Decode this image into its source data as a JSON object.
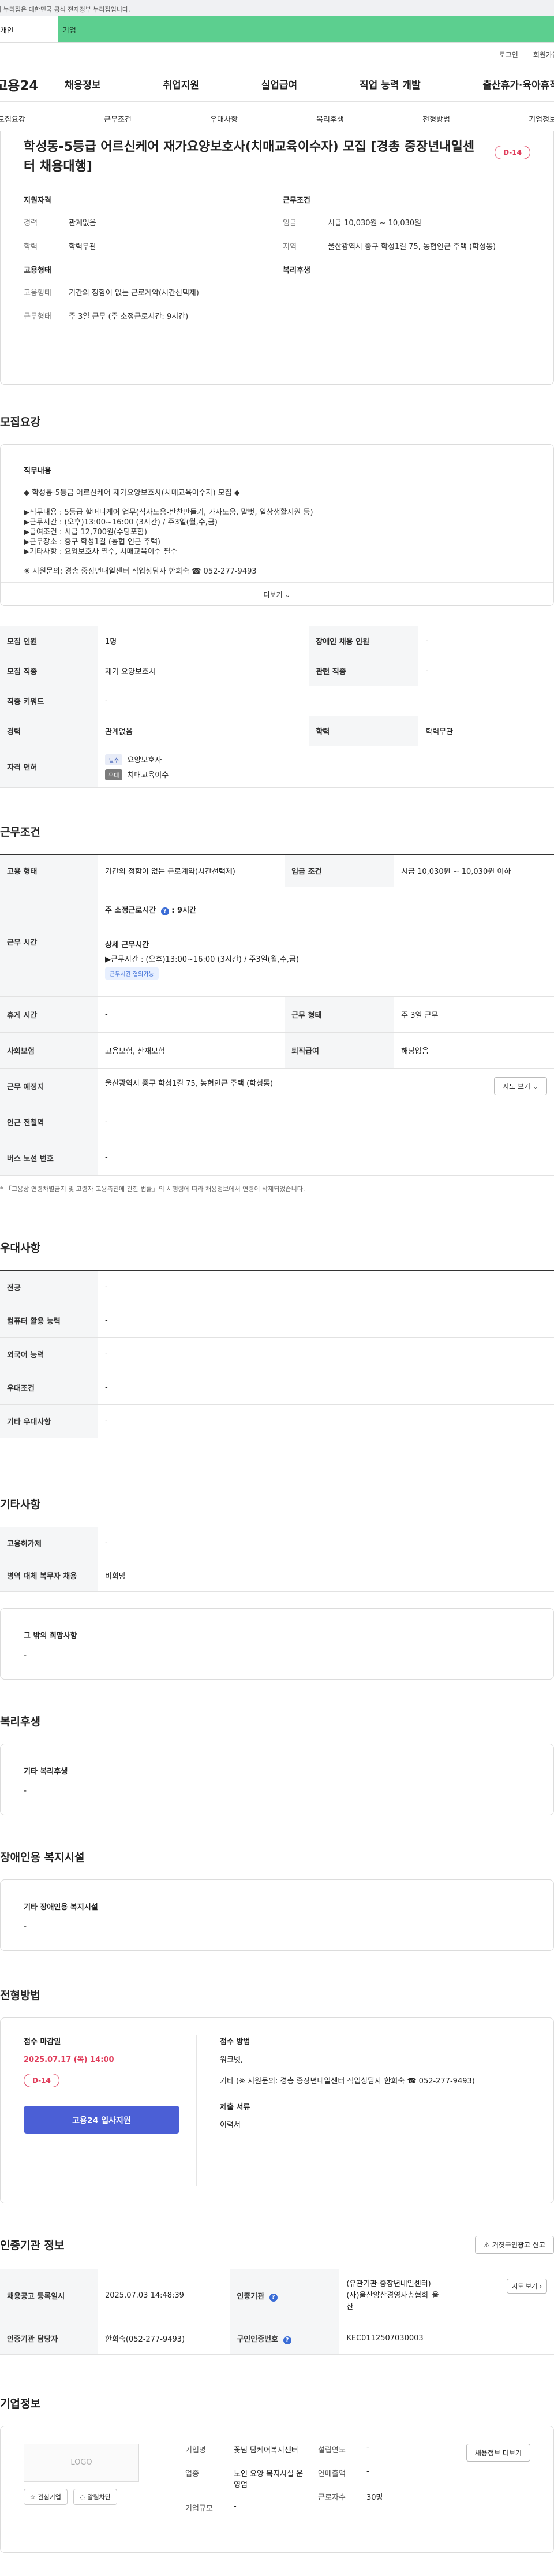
{
  "gov_notice": "이 누리집은 대한민국 공식 전자정부 누리집입니다.",
  "tabs": {
    "personal": "개인",
    "corporate": "기업"
  },
  "util": {
    "login": "로그인",
    "signup": "회원가입"
  },
  "logo": "고용24",
  "gnb": [
    "채용정보",
    "취업지원",
    "실업급여",
    "직업 능력 개발",
    "출산휴가·육아휴직"
  ],
  "snb": [
    "모집요강",
    "근무조건",
    "우대사항",
    "복리후생",
    "전형방법",
    "기업정보"
  ],
  "title": "학성동-5등급 어르신케어 재가요양보호사(치매교육이수자) 모집 [경총 중장년내일센터 채용대행]",
  "dday": "D-14",
  "summary": {
    "qual_title": "지원자격",
    "career_k": "경력",
    "career_v": "관계없음",
    "edu_k": "학력",
    "edu_v": "학력무관",
    "work_title": "근무조건",
    "wage_k": "임금",
    "wage_v": "시급 10,030원 ~ 10,030원",
    "region_k": "지역",
    "region_v": "울산광역시 중구 학성1길 75, 농협인근 주택 (학성동)",
    "emp_title": "고용형태",
    "emptype_k": "고용형태",
    "emptype_v": "기간의 정함이 없는 근로계약(시간선택제)",
    "worktype_k": "근무형태",
    "worktype_v": "주 3일 근무 (주 소정근로시간: 9시간)",
    "welfare_title": "복리후생"
  },
  "recruit": {
    "section": "모집요강",
    "job_title": "직무내용",
    "lines": [
      "◆ 학성동-5등급 어르신케어 재가요양보호사(치매교육이수자) 모집 ◆",
      "",
      "▶직무내용 : 5등급 할머니케어 업무(식사도움-반찬만들기, 가사도움, 말벗, 일상생활지원 등)",
      "▶근무시간 : (오후)13:00~16:00 (3시간) / 주3일(월,수,금)",
      "▶급여조건 : 시급 12,700원(수당포함)",
      "▶근무장소 : 중구 학성1길 (농협 인근 주택)",
      "▶기타사항 : 요양보호사 필수, 치매교육이수 필수",
      "",
      "※ 지원문의: 경총 중장년내일센터 직업상담사 한희숙 ☎ 052-277-9493"
    ],
    "more": "더보기"
  },
  "recruit_table": {
    "headcount_k": "모집 인원",
    "headcount_v": "1명",
    "disabled_k": "장애인 채용 인원",
    "disabled_v": "-",
    "job_k": "모집 직종",
    "job_v": "재가 요양보호사",
    "related_k": "관련 직종",
    "related_v": "-",
    "keyword_k": "직종 키워드",
    "keyword_v": "-",
    "career_k": "경력",
    "career_v": "관계없음",
    "edu_k": "학력",
    "edu_v": "학력무관",
    "license_k": "자격 면허",
    "license_req_tag": "필수",
    "license_req_v": "요양보호사",
    "license_pref_tag": "우대",
    "license_pref_v": "치매교육이수"
  },
  "work": {
    "section": "근무조건",
    "emptype_k": "고용 형태",
    "emptype_v": "기간의 정함이 없는 근로계약(시간선택제)",
    "wage_k": "임금 조건",
    "wage_v": "시급 10,030원 ~ 10,030원 이하",
    "hours_k": "근무 시간",
    "hours_main": "주 소정근로시간",
    "hours_main_v": "9시간",
    "hours_detail_title": "상세 근무시간",
    "hours_detail": "▶근무시간 : (오후)13:00~16:00 (3시간) / 주3일(월,수,금)",
    "hours_tag": "근무시간 협의가능",
    "rest_k": "휴게 시간",
    "rest_v": "-",
    "form_k": "근무 형태",
    "form_v": "주 3일 근무",
    "insurance_k": "사회보험",
    "insurance_v": "고용보험, 산재보험",
    "severance_k": "퇴직급여",
    "severance_v": "해당없음",
    "place_k": "근무 예정지",
    "place_v": "울산광역시 중구 학성1길 75, 농협인근 주택 (학성동)",
    "map_btn": "지도 보기",
    "subway_k": "인근 전철역",
    "subway_v": "-",
    "bus_k": "버스 노선 번호",
    "bus_v": "-",
    "note": "* 「고용상 연령차별금지 및 고령자 고용촉진에 관한 법률」의 시행령에 따라 채용정보에서 연령이 삭제되었습니다."
  },
  "pref": {
    "section": "우대사항",
    "major_k": "전공",
    "major_v": "-",
    "computer_k": "컴퓨터 활용 능력",
    "computer_v": "-",
    "lang_k": "외국어 능력",
    "lang_v": "-",
    "cond_k": "우대조건",
    "cond_v": "-",
    "etc_k": "기타 우대사항",
    "etc_v": "-"
  },
  "etc": {
    "section": "기타사항",
    "equip_k": "고용허가제",
    "equip_v": "-",
    "military_k": "병역 대체 복무자 채용",
    "military_v": "비희망",
    "other_title": "그 밖의 희망사항",
    "other_v": "-"
  },
  "welfare": {
    "section": "복리후생",
    "title": "기타 복리후생",
    "value": "-"
  },
  "disabled_facility": {
    "section": "장애인용 복지시설",
    "title": "기타 장애인용 복지시설",
    "value": "-"
  },
  "apply": {
    "section": "전형방법",
    "deadline_title": "접수 마감일",
    "deadline": "2025.07.17 (목) 14:00",
    "dday": "D-14",
    "apply_btn": "고용24 입사지원",
    "method_title": "접수 방법",
    "method_1": "워크넷,",
    "method_2": "기타 (※ 지원문의: 경총 중장년내일센터 직업상담사 한희숙 ☎ 052-277-9493)",
    "docs_title": "제출 서류",
    "docs_v": "이력서"
  },
  "cert": {
    "section": "인증기관 정보",
    "report_btn": "거짓구인광고 신고",
    "reg_k": "채용공고 등록일시",
    "reg_v": "2025.07.03 14:48:39",
    "agency_k": "인증기관",
    "agency_v": "(유관기관-중장년내일센터) (사)울산양산경영자총협회_울산",
    "map_btn": "지도 보기",
    "manager_k": "인증기관 담당자",
    "manager_v": "한희숙(052-277-9493)",
    "jobno_k": "구인인증번호",
    "jobno_v": "KEC0112507030003"
  },
  "company": {
    "section": "기업정보",
    "logo_text": "LOGO",
    "interest_btn": "관심기업",
    "alarm_btn": "알림차단",
    "name_k": "기업명",
    "name_v": "꽃님 탐케어복지센터",
    "industry_k": "업종",
    "industry_v": "노인 요양 복지시설 운영업",
    "scale_k": "기업규모",
    "scale_v": "-",
    "founded_k": "설립연도",
    "founded_v": "-",
    "sales_k": "연매출액",
    "sales_v": "-",
    "workers_k": "근로자수",
    "workers_v": "30명",
    "more_btn": "채용정보 더보기"
  }
}
